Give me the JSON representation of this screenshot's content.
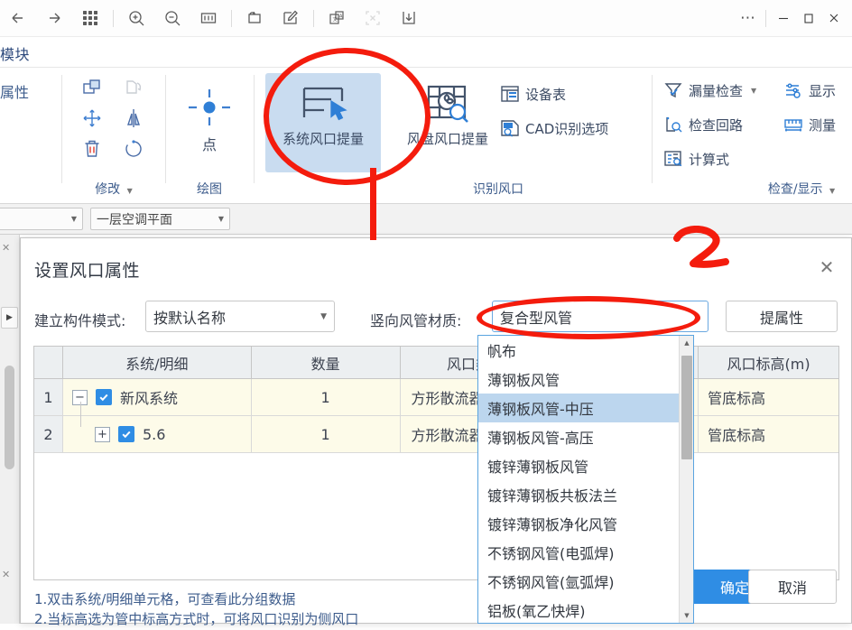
{
  "topbar": {
    "icons": [
      "back-arrow",
      "forward-arrow",
      "apps-grid",
      "zoom-in",
      "zoom-out",
      "fit-width",
      "rotate-page",
      "annotate",
      "translate",
      "select-region",
      "download"
    ],
    "more_label": "⋯",
    "window_controls": [
      "minimize",
      "maximize",
      "close"
    ]
  },
  "ribbon": {
    "tab_title": "模块",
    "properties_label": "属性",
    "groups": [
      {
        "label": "修改",
        "has_caret": true
      },
      {
        "label": "绘图",
        "has_caret": false
      },
      {
        "label": "识别风口",
        "has_caret": false
      },
      {
        "label": "检查/显示",
        "has_caret": true
      }
    ],
    "draw_button": "点",
    "big_buttons": [
      {
        "label": "系统风口提量",
        "selected": true
      },
      {
        "label": "风盘风口提量",
        "selected": false
      }
    ],
    "small_items": [
      {
        "label": "设备表",
        "icon": "device-table-icon",
        "caret": false
      },
      {
        "label": "CAD识别选项",
        "icon": "cad-recognize-icon",
        "caret": false
      },
      {
        "label": "漏量检查",
        "icon": "filter-check-icon",
        "caret": true
      },
      {
        "label": "检查回路",
        "icon": "loop-check-icon",
        "caret": false
      },
      {
        "label": "计算式",
        "icon": "formula-icon",
        "caret": false
      },
      {
        "label": "显示",
        "icon": "display-icon",
        "caret": false
      },
      {
        "label": "测量",
        "icon": "measure-icon",
        "caret": false
      }
    ]
  },
  "docbar": {
    "left_combo_value": "",
    "floor_combo_value": "一层空调平面"
  },
  "dialog": {
    "title": "设置风口属性",
    "close_label": "✕",
    "create_mode_label": "建立构件模式:",
    "create_mode_value": "按默认名称",
    "material_label": "竖向风管材质:",
    "material_value": "复合型风管",
    "extract_button": "提属性",
    "table": {
      "headers": [
        "",
        "系统/明细",
        "数量",
        "风口类型",
        "风口标高(m)"
      ],
      "rows": [
        {
          "no": "1",
          "expander": "−",
          "checked": true,
          "name": "新风系统",
          "qty": "1",
          "type": "方形散流器",
          "elev": "管底标高",
          "indent": 0
        },
        {
          "no": "2",
          "expander": "+",
          "checked": true,
          "name": "5.6",
          "qty": "1",
          "type": "方形散流器",
          "elev": "管底标高",
          "indent": 1
        }
      ]
    },
    "notes": [
      "1.双击系统/明细单元格，可查看此分组数据",
      "2.当标高选为管中标高方式时，可将风口识别为侧风口"
    ],
    "ok_button": "确定",
    "cancel_button": "取消"
  },
  "dropdown": {
    "selected_index": 2,
    "items": [
      "帆布",
      "薄钢板风管",
      "薄钢板风管-中压",
      "薄钢板风管-高压",
      "镀锌薄钢板风管",
      "镀锌薄钢板共板法兰",
      "镀锌薄钢板净化风管",
      "不锈钢风管(电弧焊)",
      "不锈钢风管(氩弧焊)",
      "铝板(氧乙快焊)"
    ]
  },
  "annotations": {
    "color": "#f41c0d",
    "marker_label": "2",
    "shapes": [
      "ribbon-highlight-ellipse",
      "connector-line",
      "material-combo-ellipse",
      "step-two-marker"
    ]
  },
  "colors": {
    "accent": "#2f8de4",
    "ribbon_text": "#3d5c8c",
    "selected_button_bg": "#c9dcf0",
    "dropdown_highlight": "#bcd6ee",
    "row_alt_bg": "#fdfbe9",
    "annotation_red": "#f41c0d"
  }
}
